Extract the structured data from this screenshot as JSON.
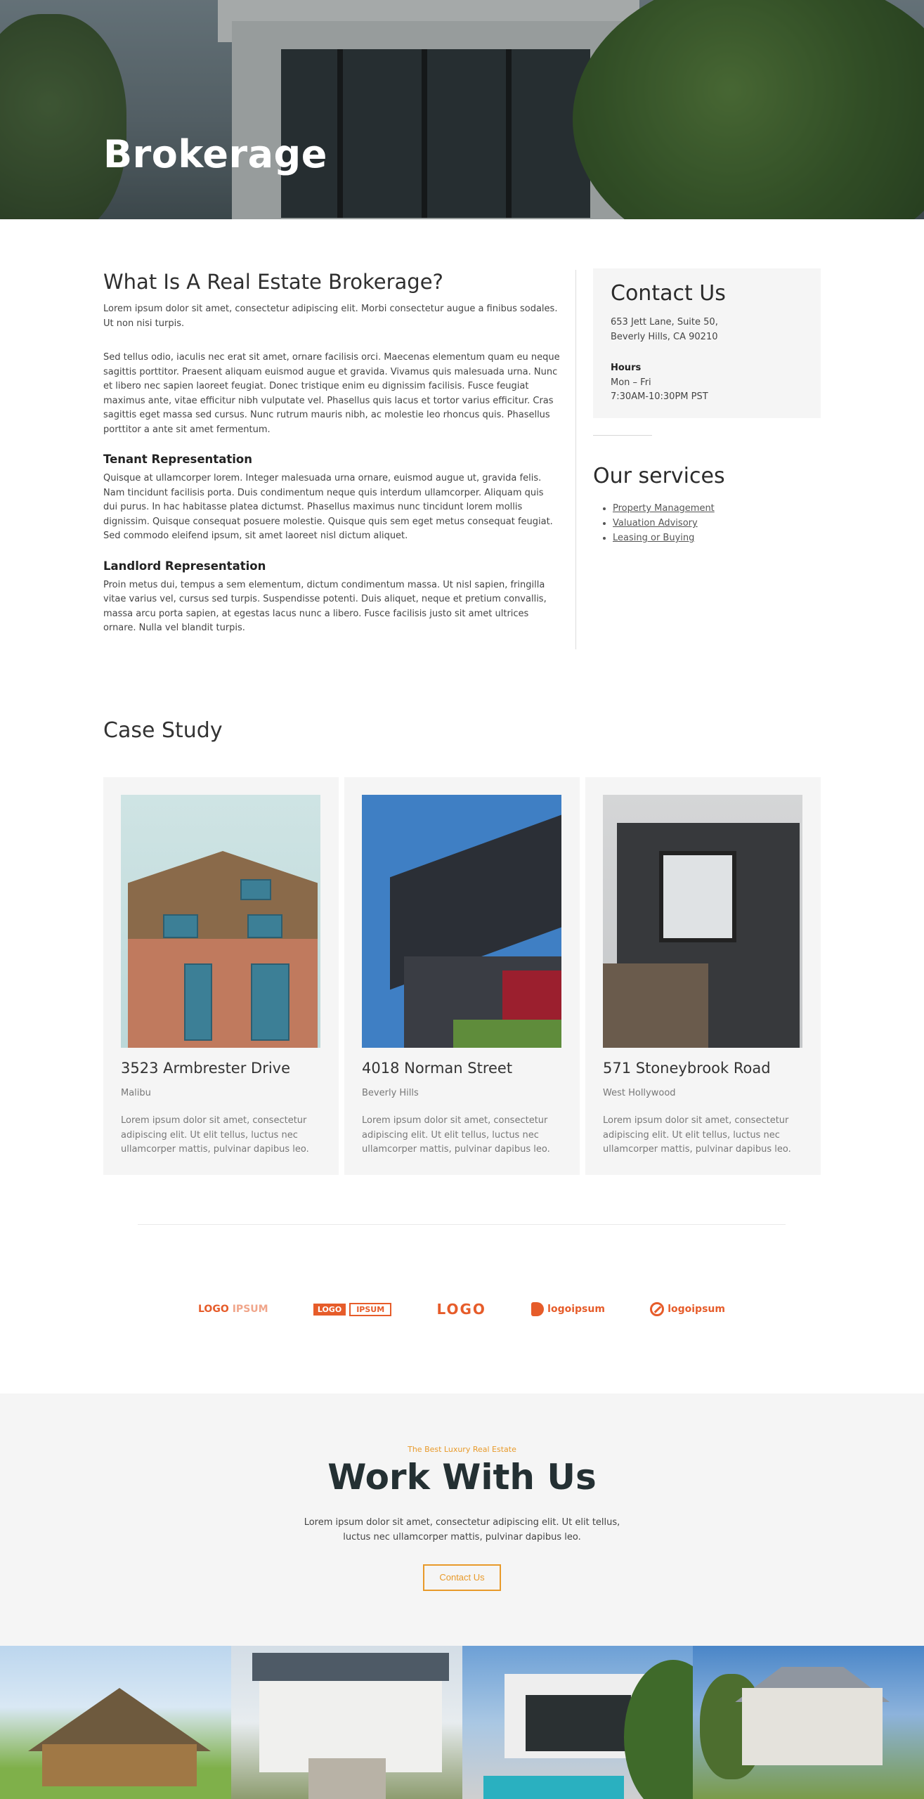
{
  "hero": {
    "title": "Brokerage"
  },
  "about": {
    "heading": "What Is A Real Estate Brokerage?",
    "intro": "Lorem ipsum dolor sit amet, consectetur adipiscing elit. Morbi consectetur augue a finibus sodales. Ut non nisi turpis.",
    "para2": "Sed tellus odio, iaculis nec erat sit amet, ornare facilisis orci. Maecenas elementum quam eu neque sagittis porttitor. Praesent aliquam euismod augue et gravida. Vivamus quis malesuada urna. Nunc et libero nec sapien laoreet feugiat. Donec tristique enim eu dignissim facilisis. Fusce feugiat maximus ante, vitae efficitur nibh vulputate vel. Phasellus quis lacus et tortor varius efficitur. Cras sagittis eget massa sed cursus. Nunc rutrum mauris nibh, ac molestie leo rhoncus quis. Phasellus porttitor a ante sit amet fermentum.",
    "tenant_heading": "Tenant Representation",
    "tenant_text": "Quisque at ullamcorper lorem. Integer malesuada urna ornare, euismod augue ut, gravida felis. Nam tincidunt facilisis porta. Duis condimentum neque quis interdum ullamcorper. Aliquam quis dui purus. In hac habitasse platea dictumst. Phasellus maximus nunc tincidunt lorem mollis dignissim. Quisque consequat posuere molestie. Quisque quis sem eget metus consequat feugiat. Sed commodo eleifend ipsum, sit amet laoreet nisl dictum aliquet.",
    "landlord_heading": "Landlord Representation",
    "landlord_text": "Proin metus dui, tempus a sem elementum, dictum condimentum massa. Ut nisl sapien, fringilla vitae varius vel, cursus sed turpis. Suspendisse potenti. Duis aliquet, neque et pretium convallis, massa arcu porta sapien, at egestas lacus nunc a libero. Fusce facilisis justo sit amet ultrices ornare. Nulla vel blandit turpis."
  },
  "contact": {
    "heading": "Contact Us",
    "address_line1": "653 Jett Lane, Suite 50,",
    "address_line2": "Beverly Hills, CA 90210",
    "hours_title": "Hours",
    "hours_days": "Mon – Fri",
    "hours_time": "7:30AM-10:30PM PST"
  },
  "services": {
    "heading": "Our services",
    "items": [
      "Property Management",
      "Valuation Advisory",
      "Leasing or Buying"
    ]
  },
  "case_study": {
    "heading": "Case Study",
    "cards": [
      {
        "title": "3523 Armbrester Drive",
        "location": "Malibu",
        "description": "Lorem ipsum dolor sit amet, consectetur adipiscing elit. Ut elit tellus, luctus nec ullamcorper mattis, pulvinar dapibus leo."
      },
      {
        "title": "4018 Norman Street",
        "location": "Beverly Hills",
        "description": "Lorem ipsum dolor sit amet, consectetur adipiscing elit. Ut elit tellus, luctus nec ullamcorper mattis, pulvinar dapibus leo."
      },
      {
        "title": "571 Stoneybrook Road",
        "location": "West Hollywood",
        "description": "Lorem ipsum dolor sit amet, consectetur adipiscing elit. Ut elit tellus, luctus nec ullamcorper mattis, pulvinar dapibus leo."
      }
    ]
  },
  "logos": {
    "logo1_a": "LOGO",
    "logo1_b": "IPSUM",
    "logo2_a": "LOGO",
    "logo2_b": "IPSUM",
    "logo3": "LOGO",
    "logo4": "logoipsum",
    "logo5": "logoipsum",
    "brand_color": "#e65c2a"
  },
  "work": {
    "eyebrow": "The Best Luxury Real Estate",
    "heading": "Work With Us",
    "text": "Lorem ipsum dolor sit amet, consectetur adipiscing elit. Ut elit tellus, luctus nec ullamcorper mattis, pulvinar dapibus leo.",
    "button": "Contact Us",
    "accent_color": "#e89a2a"
  }
}
